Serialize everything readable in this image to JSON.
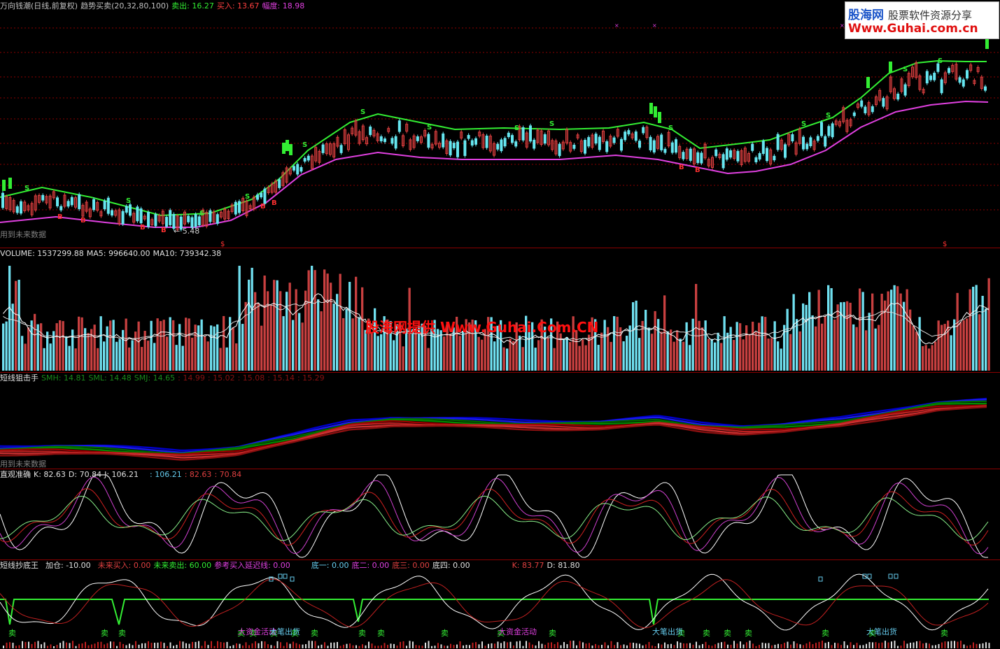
{
  "main_panel": {
    "title": "万向钱潮(日线,前复权)",
    "indicator": "趋势买卖(20,32,80,100)",
    "sell": "卖出: 16.27",
    "buy": "买入: 13.67",
    "range": "幅度: 18.98",
    "note": "用到未来数据",
    "low_label": "← 5.48",
    "colors": {
      "upper_band": "#33ee33",
      "lower_band": "#e040e0",
      "up": "#e04040",
      "down": "#66e6f0"
    }
  },
  "volume_panel": {
    "title": "VOLUME: 1537299.88",
    "ma5": "MA5: 996640.00",
    "ma10": "MA10: 739342.38"
  },
  "watermark": "股海网提供 Www.Guhai.Com.CN",
  "logo": {
    "name": "股海网",
    "slogan": "股票软件资源分享",
    "url": "Www.Guhai.com.cn"
  },
  "sniper_panel": {
    "title": "短线狙击手",
    "values": [
      "SMH: 14.81",
      "SML: 14.48",
      "SMJ: 14.65",
      ": 14.99",
      ": 15.02",
      ": 15.08",
      ": 15.14",
      ": 15.29"
    ],
    "note": "用到未来数据"
  },
  "kdj_panel": {
    "title": "直观准确",
    "k": "K: 82.63",
    "d": "D: 70.84",
    "j": "J: 106.21",
    "extra": [
      ": 106.21",
      ": 82.63",
      ": 70.84"
    ]
  },
  "bottom_panel": {
    "title": "短线抄底王",
    "items": [
      "加仓: -10.00",
      "未来买入: 0.00",
      "未来卖出: 60.00",
      "参考买入延迟线: 0.00",
      "底一: 0.00",
      "底二: 0.00",
      "底三: 0.00",
      "底四: 0.00",
      "K: 83.77",
      "D: 81.80"
    ],
    "labels": {
      "sell": "卖",
      "big_fund": "大资金活动",
      "big_out": "大笔出货"
    }
  }
}
